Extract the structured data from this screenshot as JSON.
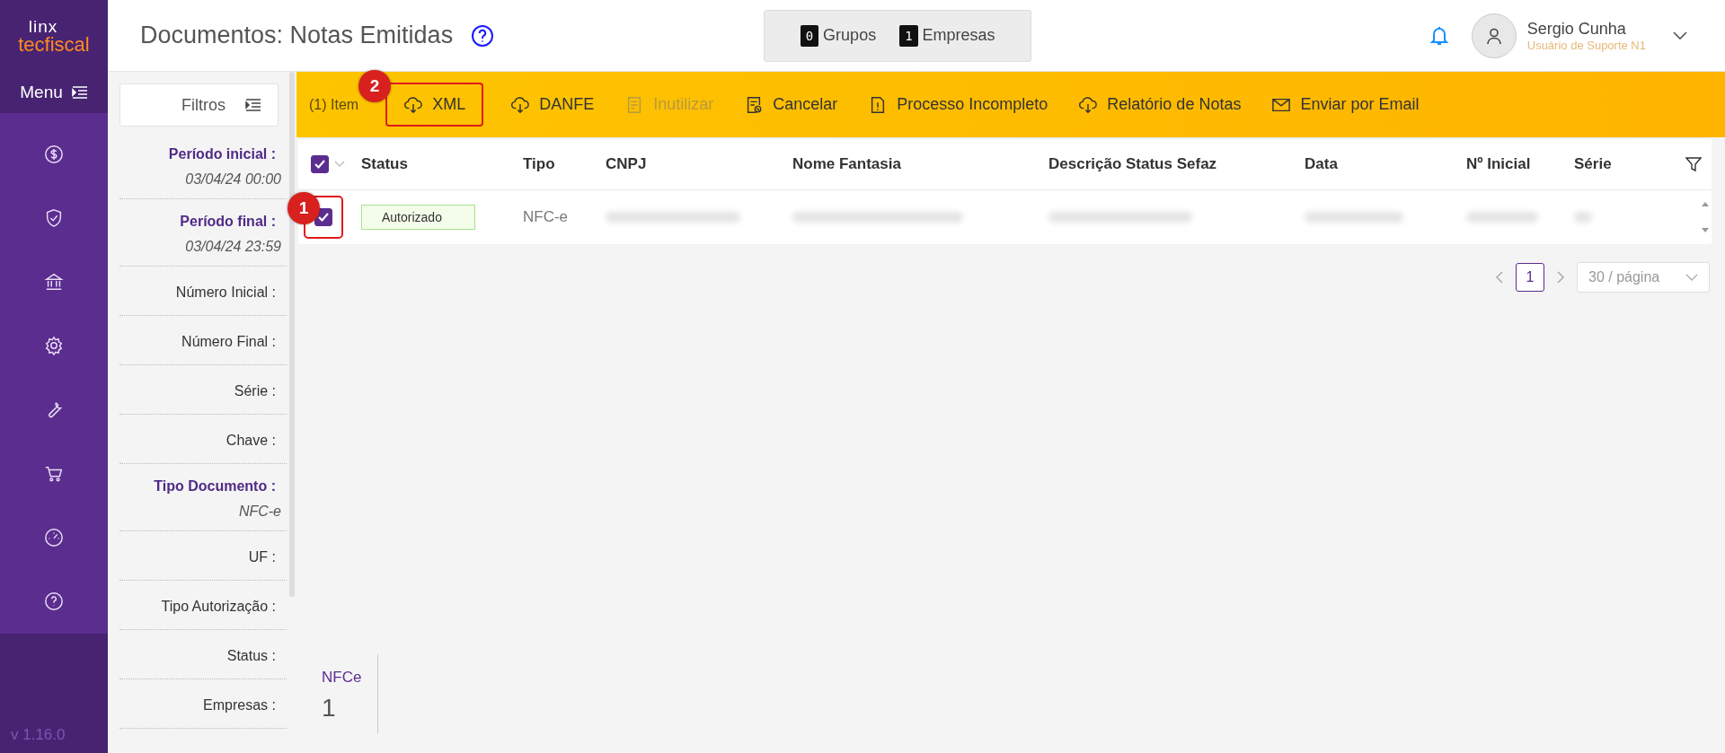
{
  "brand": {
    "line1": "linx",
    "line2": "tecfiscal"
  },
  "page_title": "Documentos: Notas Emitidas",
  "counters": [
    {
      "value": "0",
      "label": "Grupos"
    },
    {
      "value": "1",
      "label": "Empresas"
    }
  ],
  "user": {
    "name": "Sergio Cunha",
    "role": "Usuário de Suporte N1"
  },
  "menu": {
    "label": "Menu"
  },
  "nav_items": [
    {
      "kind": "dollar"
    },
    {
      "kind": "shield"
    },
    {
      "kind": "bank"
    },
    {
      "kind": "gear"
    },
    {
      "kind": "wrench"
    },
    {
      "kind": "cart"
    },
    {
      "kind": "gauge"
    },
    {
      "kind": "help"
    }
  ],
  "version": "v 1.16.0",
  "filters": {
    "button": "Filtros",
    "fields": [
      {
        "label": "Período inicial :",
        "value": "03/04/24 00:00",
        "emphasis": true
      },
      {
        "label": "Período final :",
        "value": "03/04/24 23:59",
        "emphasis": true
      },
      {
        "label": "Número Inicial :",
        "emphasis": false
      },
      {
        "label": "Número Final :",
        "emphasis": false
      },
      {
        "label": "Série :",
        "emphasis": false
      },
      {
        "label": "Chave :",
        "emphasis": false
      },
      {
        "label": "Tipo Documento :",
        "value": "NFC-e",
        "emphasis": true
      },
      {
        "label": "UF :",
        "emphasis": false
      },
      {
        "label": "Tipo Autorização :",
        "emphasis": false
      },
      {
        "label": "Status :",
        "emphasis": false
      },
      {
        "label": "Empresas :",
        "emphasis": false
      }
    ]
  },
  "toolbar": {
    "selection": "(1) Item",
    "actions": [
      {
        "label": "XML",
        "kind": "cloud",
        "disabled": false,
        "annotation": "2"
      },
      {
        "label": "DANFE",
        "kind": "cloud",
        "disabled": false
      },
      {
        "label": "Inutilizar",
        "kind": "doc",
        "disabled": true
      },
      {
        "label": "Cancelar",
        "kind": "cancel",
        "disabled": false
      },
      {
        "label": "Processo Incompleto",
        "kind": "alert",
        "disabled": false
      },
      {
        "label": "Relatório de Notas",
        "kind": "cloud",
        "disabled": false
      },
      {
        "label": "Enviar por Email",
        "kind": "mail",
        "disabled": false
      }
    ]
  },
  "table": {
    "all_selected": true,
    "columns": [
      "Status",
      "Tipo",
      "CNPJ",
      "Nome Fantasia",
      "Descrição Status Sefaz",
      "Data",
      "Nº Inicial",
      "Série"
    ],
    "rows": [
      {
        "selected": true,
        "annotation": "1",
        "cells": [
          {
            "kind": "status",
            "text": "Autorizado"
          },
          {
            "kind": "text",
            "text": "NFC-e"
          },
          {
            "kind": "blurred"
          },
          {
            "kind": "blurred"
          },
          {
            "kind": "blurred"
          },
          {
            "kind": "blurred"
          },
          {
            "kind": "blurred"
          },
          {
            "kind": "blurred"
          }
        ]
      }
    ]
  },
  "pagination": {
    "pages": [
      {
        "label": "1",
        "selected": true
      }
    ],
    "page_size": "30 / página"
  },
  "summary": [
    {
      "label": "NFCe",
      "count": "1"
    }
  ]
}
